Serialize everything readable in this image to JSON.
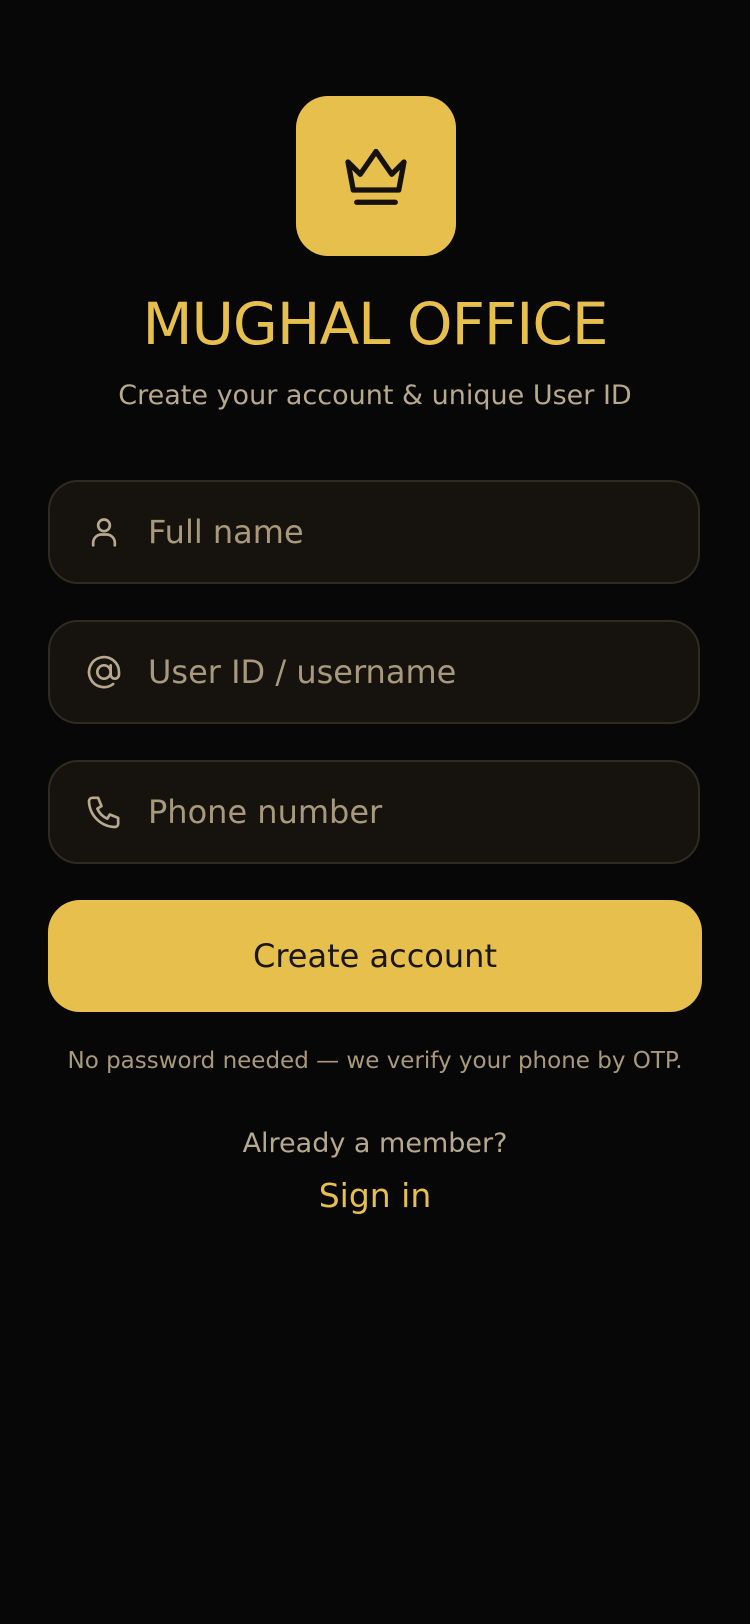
{
  "brand": {
    "logo_icon": "crown-icon",
    "title": "MUGHAL OFFICE",
    "subtitle": "Create your account & unique User ID",
    "accent_color": "#e6bf4c",
    "background_color": "#080707"
  },
  "form": {
    "full_name": {
      "icon": "user-icon",
      "placeholder": "Full name",
      "value": ""
    },
    "username": {
      "icon": "at-sign-icon",
      "placeholder": "User ID / username",
      "value": ""
    },
    "phone": {
      "icon": "phone-icon",
      "placeholder": "Phone number",
      "value": ""
    },
    "submit_label": "Create account",
    "hint": "No password needed — we verify your phone by OTP."
  },
  "footer": {
    "question": "Already a member?",
    "sign_in_label": "Sign in"
  }
}
